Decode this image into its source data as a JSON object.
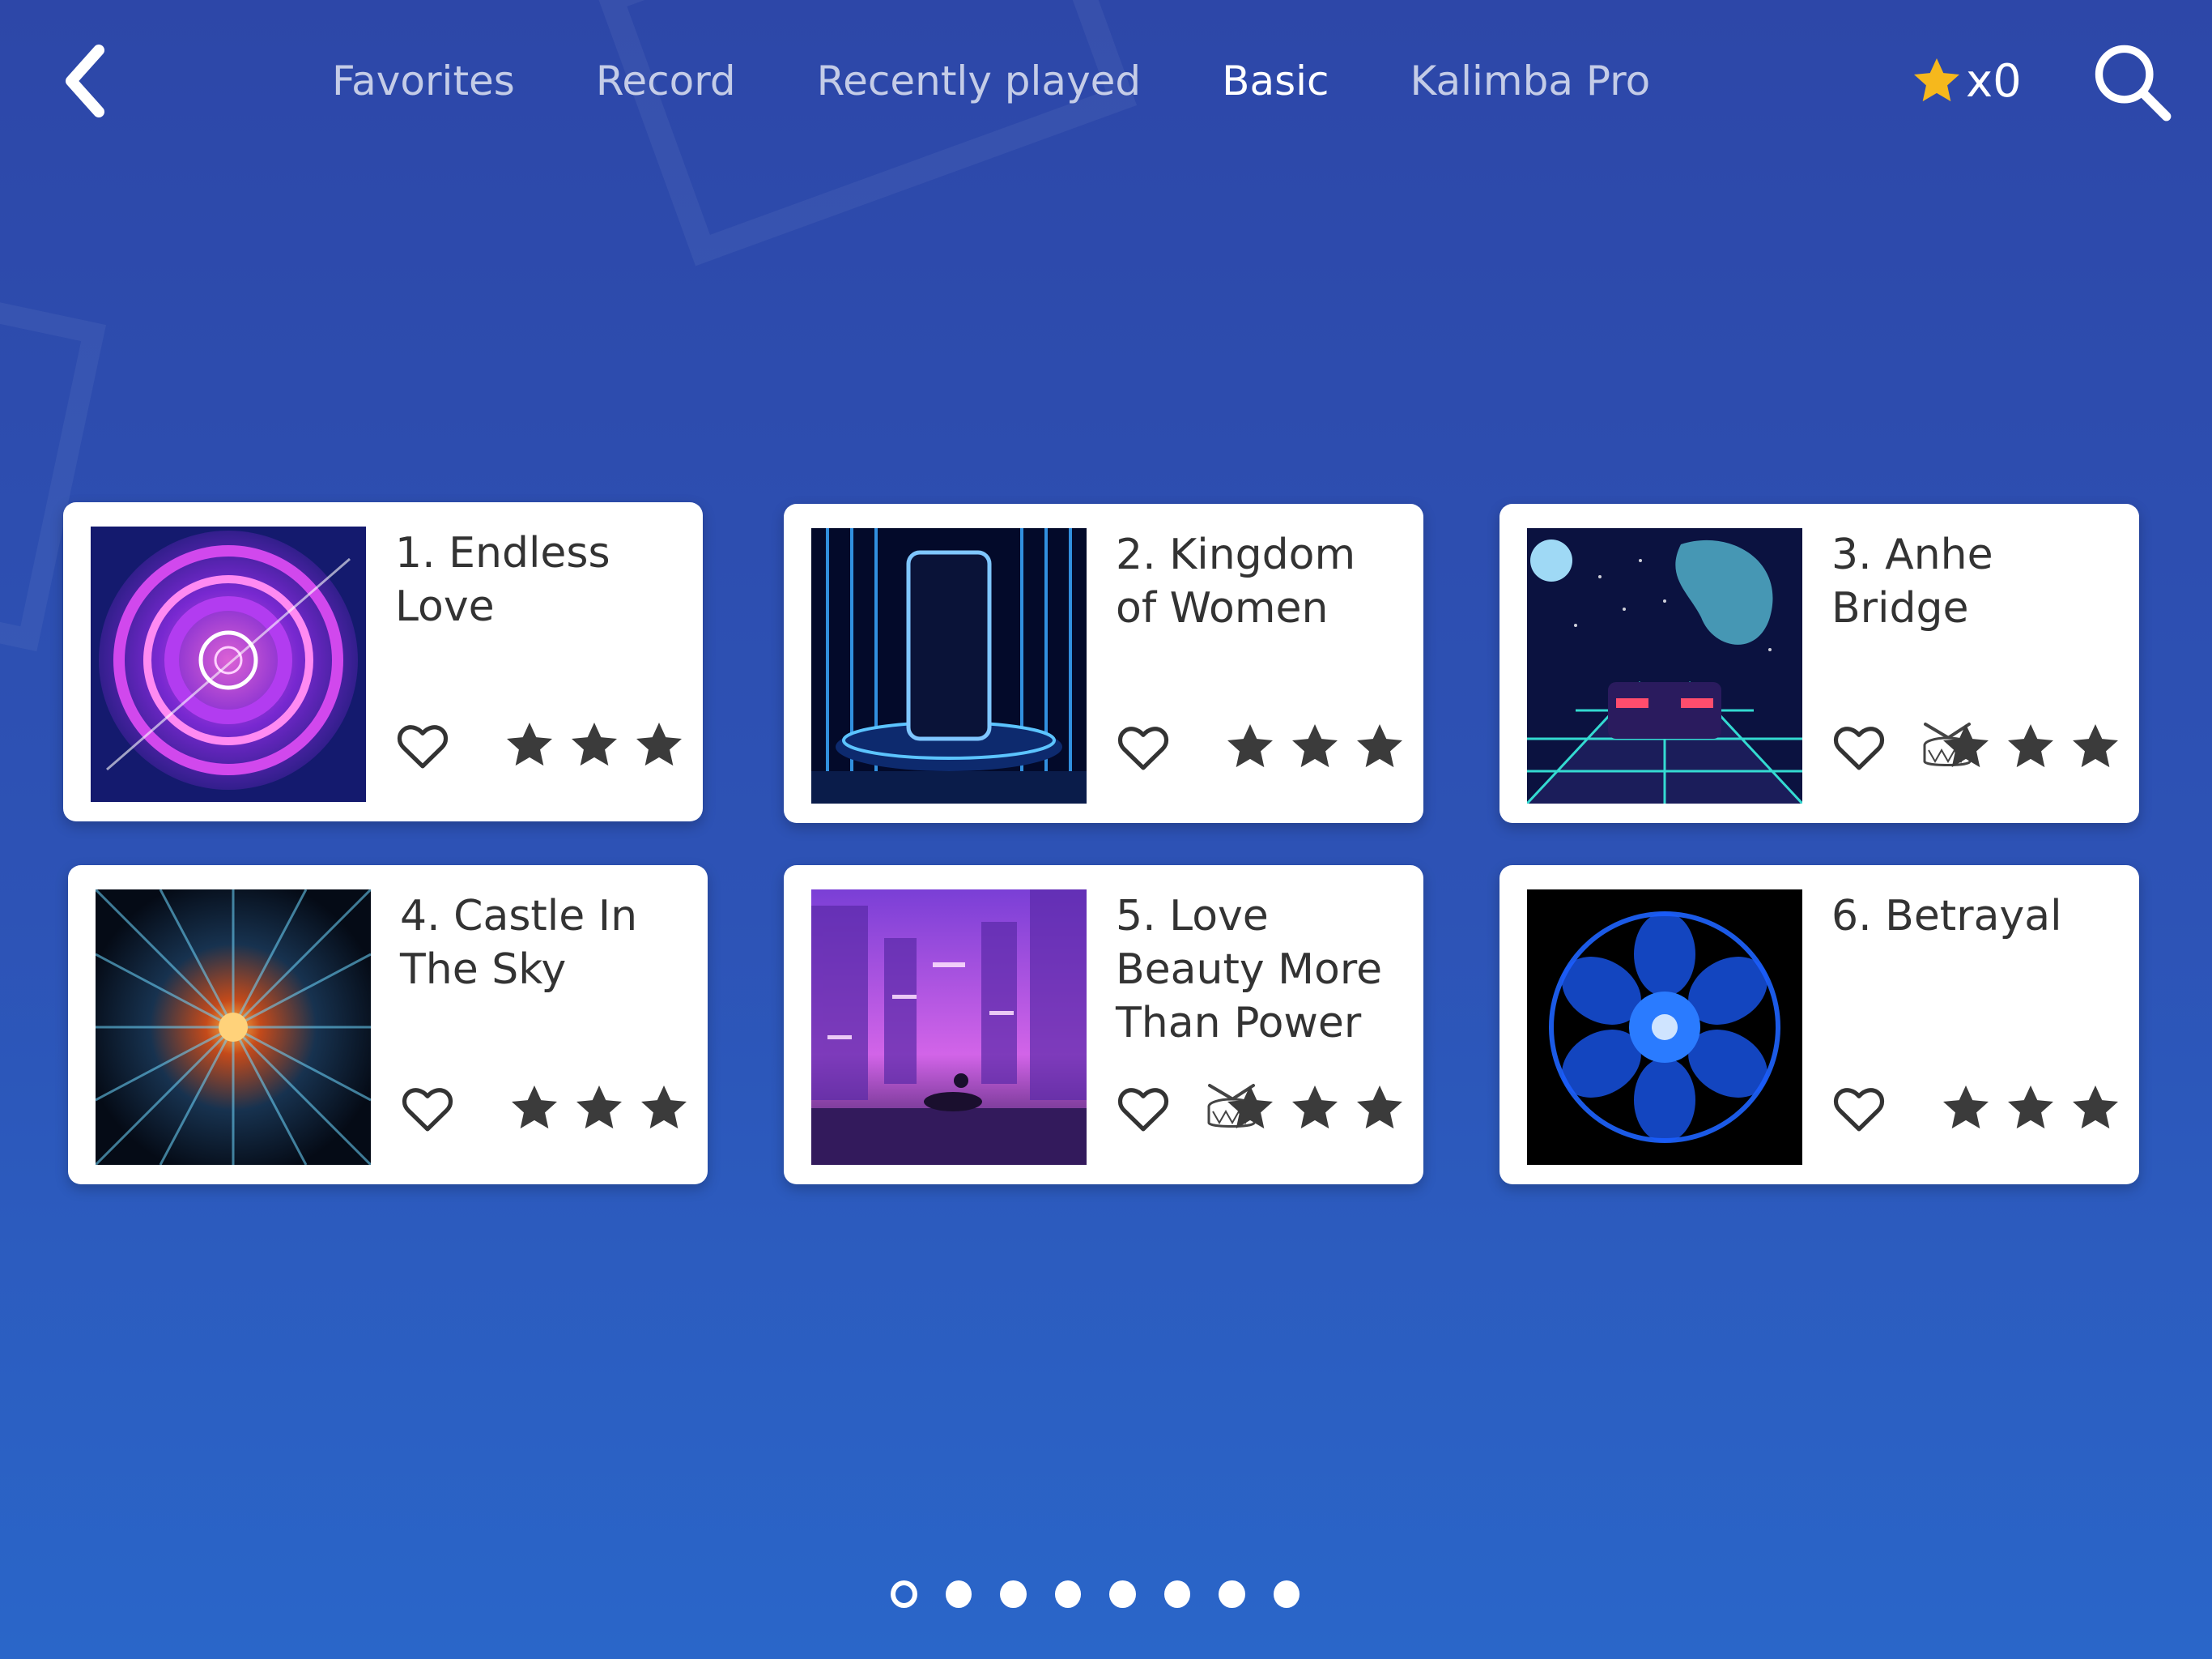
{
  "header": {
    "tabs": [
      {
        "label": "Favorites",
        "active": false
      },
      {
        "label": "Record",
        "active": false
      },
      {
        "label": "Recently played",
        "active": false
      },
      {
        "label": "Basic",
        "active": true
      },
      {
        "label": "Kalimba Pro",
        "active": false
      }
    ],
    "coins_label": "x0",
    "icons": {
      "back": "back-arrow-icon",
      "coin": "star-coin-icon",
      "search": "search-icon"
    }
  },
  "songs": [
    {
      "title": "1. Endless Love",
      "favorite": false,
      "stars_earned": 0,
      "stars_total": 3,
      "drum_badge": false,
      "cover": "neon-rings-artwork"
    },
    {
      "title": "2. Kingdom of Women",
      "favorite": false,
      "stars_earned": 0,
      "stars_total": 3,
      "drum_badge": false,
      "cover": "neon-stage-artwork"
    },
    {
      "title": "3. Anhe Bridge",
      "favorite": false,
      "stars_earned": 0,
      "stars_total": 3,
      "drum_badge": true,
      "cover": "retro-car-artwork"
    },
    {
      "title": "4. Castle In The Sky",
      "favorite": false,
      "stars_earned": 0,
      "stars_total": 3,
      "drum_badge": false,
      "cover": "light-tunnel-artwork"
    },
    {
      "title": "5. Love Beauty More Than Power",
      "favorite": false,
      "stars_earned": 0,
      "stars_total": 3,
      "drum_badge": true,
      "cover": "neon-city-artwork"
    },
    {
      "title": "6. Betrayal",
      "favorite": false,
      "stars_earned": 0,
      "stars_total": 3,
      "drum_badge": false,
      "cover": "blue-mandala-artwork"
    }
  ],
  "pagination": {
    "current_page": 1,
    "total_pages": 8
  },
  "colors": {
    "background_top": "#2d47a8",
    "background_bottom": "#2a66c9",
    "card": "#ffffff",
    "text": "#333333",
    "star_empty": "#3b3b3b",
    "coin_star": "#f6b81c"
  }
}
